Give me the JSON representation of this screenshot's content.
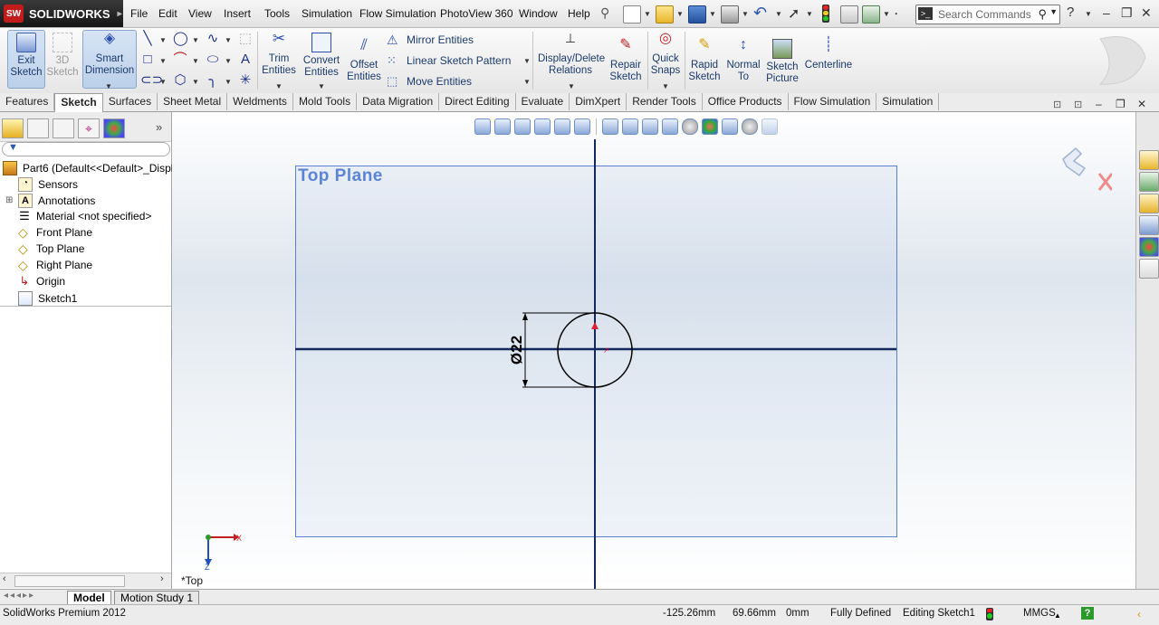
{
  "app": {
    "logo_text": "SOLIDWORKS",
    "logo_badge": "SW"
  },
  "menu": [
    "File",
    "Edit",
    "View",
    "Insert",
    "Tools",
    "Simulation",
    "Flow Simulation",
    "PhotoView 360",
    "Window",
    "Help"
  ],
  "search": {
    "placeholder": "Search Commands"
  },
  "command_manager": {
    "exit_sketch": "Exit Sketch",
    "sketch_3d": "3D Sketch",
    "smart_dimension": "Smart Dimension",
    "trim_entities": "Trim Entities",
    "convert_entities": "Convert Entities",
    "offset_entities": "Offset Entities",
    "mirror_entities": "Mirror Entities",
    "linear_sketch_pattern": "Linear Sketch Pattern",
    "move_entities": "Move Entities",
    "display_delete_relations": "Display/Delete Relations",
    "repair_sketch": "Repair Sketch",
    "quick_snaps": "Quick Snaps",
    "rapid_sketch": "Rapid Sketch",
    "normal_to": "Normal To",
    "sketch_picture": "Sketch Picture",
    "centerline": "Centerline"
  },
  "tabs": [
    "Features",
    "Sketch",
    "Surfaces",
    "Sheet Metal",
    "Weldments",
    "Mold Tools",
    "Data Migration",
    "Direct Editing",
    "Evaluate",
    "DimXpert",
    "Render Tools",
    "Office Products",
    "Flow Simulation",
    "Simulation"
  ],
  "active_tab": "Sketch",
  "tree": {
    "root": "Part6  (Default<<Default>_Displa",
    "items": [
      "Sensors",
      "Annotations",
      "Material <not specified>",
      "Front Plane",
      "Top Plane",
      "Right Plane",
      "Origin",
      "Sketch1"
    ]
  },
  "graphics": {
    "plane_label": "Top Plane",
    "dimension_text": "Ø22",
    "view_name": "*Top",
    "triad_x": "X",
    "triad_z": "Z"
  },
  "bottom_tabs": [
    "Model",
    "Motion Study 1"
  ],
  "status": {
    "product": "SolidWorks Premium 2012",
    "x": "-125.26mm",
    "y": "69.66mm",
    "z": "0mm",
    "sketch_state": "Fully Defined",
    "editing": "Editing Sketch1",
    "units": "MMGS"
  },
  "colors": {
    "plane_border": "#5c7fcf",
    "axis_line": "#13285f",
    "accent_blue": "#1a3a6b"
  }
}
